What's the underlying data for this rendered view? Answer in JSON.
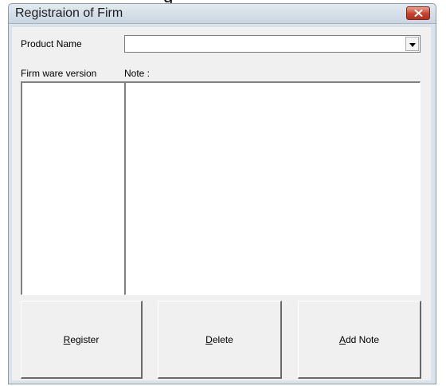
{
  "window": {
    "title": "Registraion of Firm",
    "partial_glyph": "g"
  },
  "labels": {
    "product_name": "Product Name",
    "firmware_version": "Firm ware version",
    "note": "Note :"
  },
  "product_combo": {
    "value": ""
  },
  "buttons": {
    "register": {
      "accel": "R",
      "rest": "egister"
    },
    "delete": {
      "accel": "D",
      "rest": "elete"
    },
    "add_note": {
      "accel": "A",
      "rest": "dd Note"
    }
  },
  "icons": {
    "close": "close-icon",
    "dropdown": "chevron-down-icon"
  }
}
